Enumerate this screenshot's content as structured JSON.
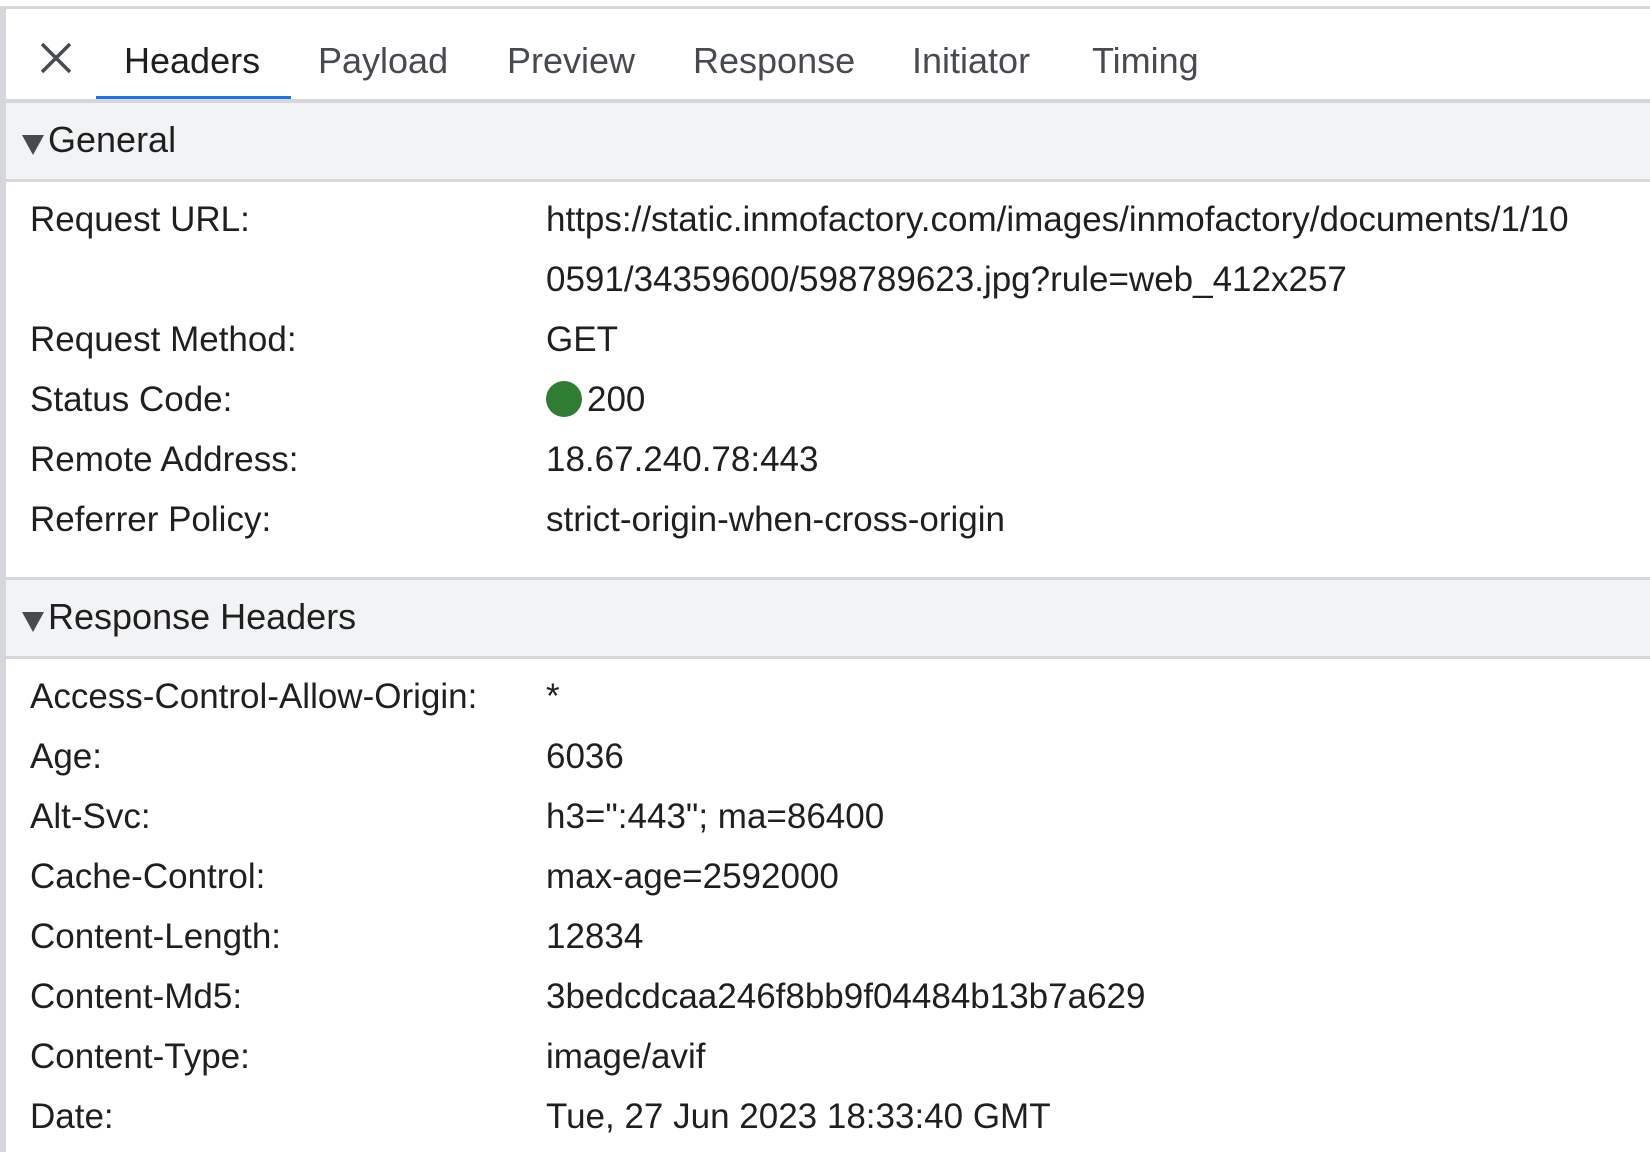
{
  "tabs": [
    "Headers",
    "Payload",
    "Preview",
    "Response",
    "Initiator",
    "Timing"
  ],
  "active_tab": "Headers",
  "general": {
    "title": "General",
    "request_url_label": "Request URL:",
    "request_url_line1": "https://static.inmofactory.com/images/inmofactory/documents/1/10",
    "request_url_line2": "0591/34359600/598789623.jpg?rule=web_412x257",
    "request_method_label": "Request Method:",
    "request_method": "GET",
    "status_code_label": "Status Code:",
    "status_code": "200",
    "status_color": "#2e7d32",
    "remote_address_label": "Remote Address:",
    "remote_address": "18.67.240.78:443",
    "referrer_policy_label": "Referrer Policy:",
    "referrer_policy": "strict-origin-when-cross-origin"
  },
  "response_headers": {
    "title": "Response Headers",
    "rows": [
      {
        "key": "Access-Control-Allow-Origin:",
        "value": "*"
      },
      {
        "key": "Age:",
        "value": "6036"
      },
      {
        "key": "Alt-Svc:",
        "value": "h3=\":443\"; ma=86400"
      },
      {
        "key": "Cache-Control:",
        "value": "max-age=2592000"
      },
      {
        "key": "Content-Length:",
        "value": "12834"
      },
      {
        "key": "Content-Md5:",
        "value": "3bedcdcaa246f8bb9f04484b13b7a629"
      },
      {
        "key": "Content-Type:",
        "value": "image/avif"
      },
      {
        "key": "Date:",
        "value": "Tue, 27 Jun 2023 18:33:40 GMT"
      }
    ]
  },
  "icons": {
    "close": "close-icon",
    "expand": "triangle-down-icon"
  },
  "colors": {
    "accent": "#1a73e8",
    "section_bg": "#f1f3f4",
    "border": "#d5d7da"
  }
}
